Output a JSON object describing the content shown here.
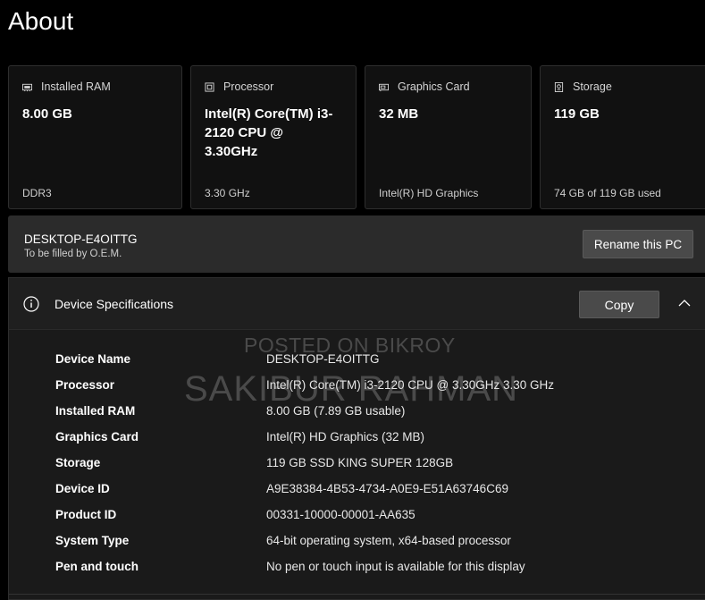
{
  "page": {
    "title": "About"
  },
  "cards": [
    {
      "label": "Installed RAM",
      "value": "8.00 GB",
      "footer": "DDR3",
      "icon": "memory-icon"
    },
    {
      "label": "Processor",
      "value": "Intel(R) Core(TM) i3-2120 CPU @ 3.30GHz",
      "footer": "3.30 GHz",
      "icon": "processor-icon"
    },
    {
      "label": "Graphics Card",
      "value": "32 MB",
      "footer": "Intel(R) HD Graphics",
      "icon": "graphics-card-icon"
    },
    {
      "label": "Storage",
      "value": "119 GB",
      "footer": "74 GB of 119 GB used",
      "icon": "storage-icon"
    }
  ],
  "pc": {
    "name": "DESKTOP-E4OITTG",
    "subtitle": "To be filled by O.E.M.",
    "rename_label": "Rename this PC"
  },
  "device_specs": {
    "title": "Device Specifications",
    "copy_label": "Copy",
    "rows": [
      {
        "label": "Device Name",
        "value": "DESKTOP-E4OITTG"
      },
      {
        "label": "Processor",
        "value": "Intel(R) Core(TM) i3-2120 CPU @ 3.30GHz   3.30 GHz"
      },
      {
        "label": "Installed RAM",
        "value": "8.00 GB (7.89 GB usable)"
      },
      {
        "label": "Graphics Card",
        "value": "Intel(R) HD Graphics (32 MB)"
      },
      {
        "label": "Storage",
        "value": "119 GB SSD KING SUPER 128GB"
      },
      {
        "label": "Device ID",
        "value": "A9E38384-4B53-4734-A0E9-E51A63746C69"
      },
      {
        "label": "Product ID",
        "value": "00331-10000-00001-AA635"
      },
      {
        "label": "System Type",
        "value": "64-bit operating system, x64-based processor"
      },
      {
        "label": "Pen and touch",
        "value": "No pen or touch input is available for this display"
      }
    ]
  },
  "watermark": {
    "line1": "POSTED ON BIKROY",
    "line2": "SAKIBUR RAHMAN"
  },
  "colors": {
    "background": "#000000",
    "card": "#111111",
    "bar": "#2b2b2b",
    "button": "#4a4a4a"
  }
}
